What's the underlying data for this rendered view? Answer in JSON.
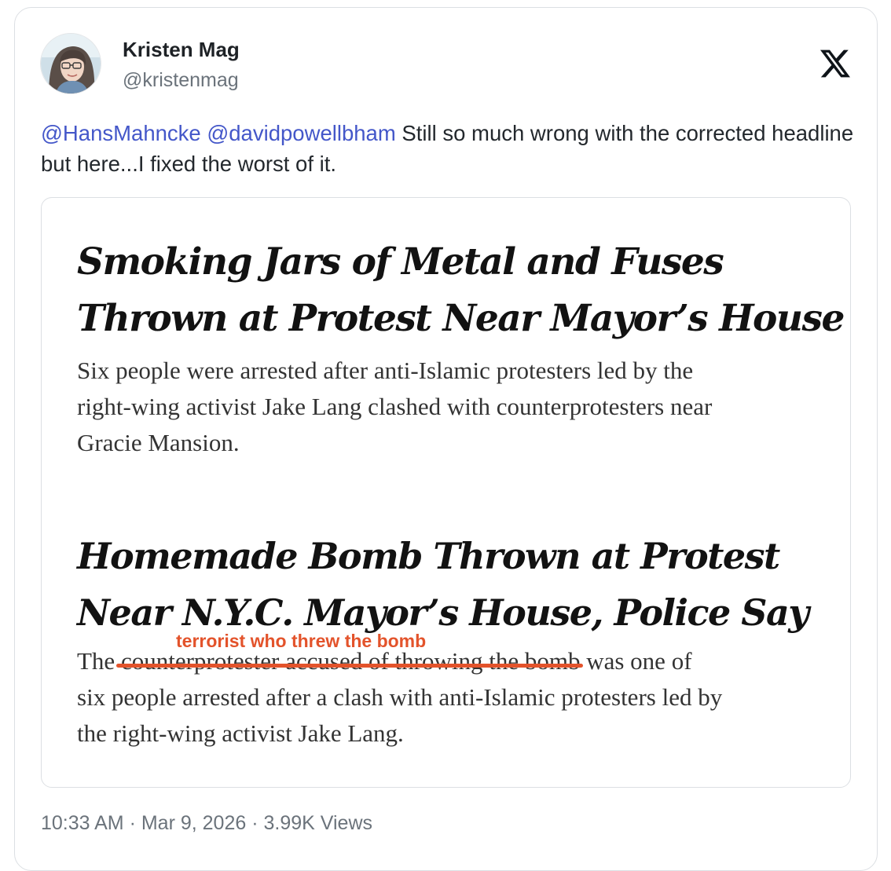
{
  "author": {
    "display_name": "Kristen Mag",
    "handle": "@kristenmag",
    "avatar_icon": "profile-photo"
  },
  "brand": {
    "logo_icon": "x-logo",
    "color": "#0f1419"
  },
  "tweet": {
    "mention_1": "@HansMahncke",
    "mention_2": "@davidpowellbham",
    "body": "Still so much wrong with the corrected headline but here...I fixed the worst of it.",
    "mention_color": "#4457c9"
  },
  "media": {
    "article_1": {
      "headline_line_1": "Smoking Jars of Metal and Fuses",
      "headline_line_2": "Thrown at Protest Near Mayor’s House",
      "summary_line_1": "Six people were arrested after anti-Islamic protesters led by the",
      "summary_line_2": "right-wing activist Jake Lang clashed with counterprotesters near",
      "summary_line_3": "Gracie Mansion."
    },
    "article_2": {
      "headline_line_1": "Homemade Bomb Thrown at Protest",
      "headline_line_2": "Near N.Y.C. Mayor’s House, Police Say",
      "summary_prefix": "The",
      "struck_text": "counterprotester accused of throwing the bomb",
      "summary_suffix": "was one of",
      "summary_line_2": "six people arrested after a clash with anti-Islamic protesters led by",
      "summary_line_3": "the right-wing activist Jake Lang.",
      "inserted_text": "terrorist who threw the bomb",
      "annotation_color": "#e3532b"
    }
  },
  "footer": {
    "time": "10:33 AM",
    "separator_1": " · ",
    "date": "Mar 9, 2026",
    "separator_2": " · ",
    "views": "3.99K Views"
  }
}
